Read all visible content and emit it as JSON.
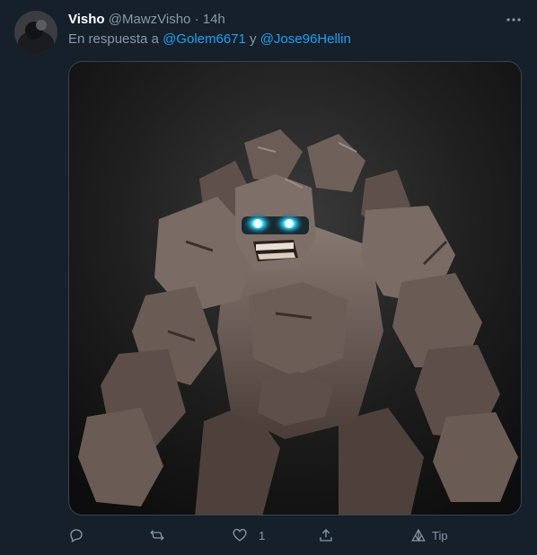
{
  "tweet": {
    "display_name": "Visho",
    "handle": "@MawzVisho",
    "separator": "·",
    "time": "14h",
    "reply_prefix": "En respuesta a",
    "mention_1": "@Golem6671",
    "reply_joiner": "y",
    "mention_2": "@Jose96Hellin"
  },
  "actions": {
    "reply_icon": "reply-icon",
    "retweet_icon": "retweet-icon",
    "like_icon": "heart-icon",
    "like_count": "1",
    "share_icon": "share-icon",
    "tip_icon": "tip-icon",
    "tip_label": "Tip"
  },
  "colors": {
    "background": "#15202b",
    "accent": "#1da1f2",
    "muted": "#8899a6",
    "golem_eyes": "#33d6ff"
  }
}
